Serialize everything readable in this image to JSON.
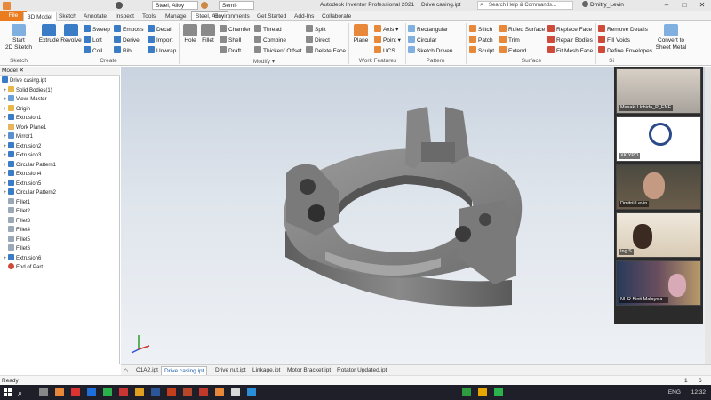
{
  "app": {
    "title": "Autodesk Inventor Professional 2021",
    "document": "Drive casing.ipt",
    "material": "Steel, Alloy",
    "appearance": "Semi-Polish",
    "material_tooltip": "Steel, Alloy",
    "search_placeholder": "Search Help & Commands...",
    "user": "Dmitry_Levin",
    "window_buttons": [
      "–",
      "□",
      "✕"
    ]
  },
  "tabs": [
    "File",
    "3D Model",
    "Sketch",
    "Annotate",
    "Inspect",
    "Tools",
    "Manage",
    "View",
    "Environments",
    "Get Started",
    "Add-Ins",
    "Collaborate"
  ],
  "active_tab": "3D Model",
  "ribbon": {
    "sketch": {
      "start_label": "Start\n2D Sketch",
      "group": "Sketch"
    },
    "create": {
      "big": [
        "Extrude",
        "Revolve"
      ],
      "col1": [
        "Sweep",
        "Loft",
        "Coil"
      ],
      "col2": [
        "Emboss",
        "Derive",
        "Rib"
      ],
      "col3": [
        "Decal",
        "Import",
        "Unwrap"
      ],
      "group": "Create"
    },
    "modify": {
      "big": [
        "Hole",
        "Fillet"
      ],
      "col1": [
        "Chamfer",
        "Shell",
        "Draft"
      ],
      "col2": [
        "Thread",
        "Combine",
        "Thicken/ Offset"
      ],
      "col3": [
        "Split",
        "Direct",
        "Delete Face"
      ],
      "group": "Modify ▾"
    },
    "work": {
      "big": "Plane",
      "col1": [
        "Axis ▾",
        "Point ▾",
        "UCS"
      ],
      "group": "Work Features"
    },
    "pattern": {
      "col1": [
        "Rectangular",
        "Circular",
        "Sketch Driven"
      ],
      "group": "Pattern"
    },
    "surface": {
      "col1": [
        "Stitch",
        "Patch",
        "Sculpt"
      ],
      "col2": [
        "Ruled Surface",
        "Trim",
        "Extend"
      ],
      "col3": [
        "Replace Face",
        "Repair Bodies",
        "Fit Mesh Face"
      ],
      "group": "Surface"
    },
    "simplify": {
      "col1": [
        "Remove Details",
        "Fill Voids",
        "Define Envelopes"
      ],
      "big": "Convert to\nSheet Metal",
      "group": "Si"
    }
  },
  "browser": {
    "header": "Model  ✕",
    "items": [
      {
        "label": "Drive casing.ipt",
        "icon": "part-icon",
        "level": 0,
        "exp": ""
      },
      {
        "label": "Solid Bodies(1)",
        "icon": "folder-icon",
        "level": 1,
        "exp": "+"
      },
      {
        "label": "View: Master",
        "icon": "view-icon",
        "level": 1,
        "exp": "+"
      },
      {
        "label": "Origin",
        "icon": "folder-icon",
        "level": 1,
        "exp": "+"
      },
      {
        "label": "Extrusion1",
        "icon": "extrude-icon",
        "level": 1,
        "exp": "+"
      },
      {
        "label": "Work Plane1",
        "icon": "plane-icon",
        "level": 1,
        "exp": ""
      },
      {
        "label": "Mirror1",
        "icon": "mirror-icon",
        "level": 1,
        "exp": "+"
      },
      {
        "label": "Extrusion2",
        "icon": "extrude-icon",
        "level": 1,
        "exp": "+"
      },
      {
        "label": "Extrusion3",
        "icon": "extrude-icon",
        "level": 1,
        "exp": "+"
      },
      {
        "label": "Circular Pattern1",
        "icon": "pattern-icon",
        "level": 1,
        "exp": "+"
      },
      {
        "label": "Extrusion4",
        "icon": "extrude-icon",
        "level": 1,
        "exp": "+"
      },
      {
        "label": "Extrusion5",
        "icon": "extrude-icon",
        "level": 1,
        "exp": "+"
      },
      {
        "label": "Circular Pattern2",
        "icon": "pattern-icon",
        "level": 1,
        "exp": "+"
      },
      {
        "label": "Fillet1",
        "icon": "fillet-icon",
        "level": 1,
        "exp": ""
      },
      {
        "label": "Fillet2",
        "icon": "fillet-icon",
        "level": 1,
        "exp": ""
      },
      {
        "label": "Fillet3",
        "icon": "fillet-icon",
        "level": 1,
        "exp": ""
      },
      {
        "label": "Fillet4",
        "icon": "fillet-icon",
        "level": 1,
        "exp": ""
      },
      {
        "label": "Fillet5",
        "icon": "fillet-icon",
        "level": 1,
        "exp": ""
      },
      {
        "label": "Fillet6",
        "icon": "fillet-icon",
        "level": 1,
        "exp": ""
      },
      {
        "label": "Extrusion6",
        "icon": "extrude-icon",
        "level": 1,
        "exp": "+"
      },
      {
        "label": "End of Part",
        "icon": "end-of-part-icon",
        "level": 1,
        "exp": ""
      }
    ]
  },
  "doc_tabs": [
    "C1A2.ipt",
    "Drive casing.ipt",
    "Drive nut.ipt",
    "Linkage.ipt",
    "Motor Bracket.ipt",
    "Rotator Updated.ipt"
  ],
  "active_doc": "Drive casing.ipt",
  "status": "Ready",
  "status_right": [
    "1",
    "6"
  ],
  "meeting": {
    "participants": [
      "Masaki Uchida_P_ENE",
      "XK YPO",
      "Dmitrii Levin",
      "Ing S",
      "NUR Binti Malaysia..."
    ]
  },
  "tray": {
    "lang": "ENG",
    "time": "12:32"
  },
  "colors": {
    "file_tab": "#ea7c1f",
    "accent": "#3b7cc6",
    "taskbar": "#1f1f2a"
  }
}
